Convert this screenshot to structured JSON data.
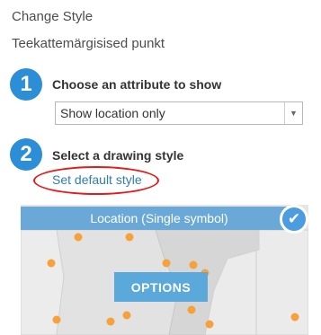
{
  "panel": {
    "title": "Change Style",
    "layer_name": "Teekattemärgisised punkt"
  },
  "steps": [
    {
      "number": "1",
      "label": "Choose an attribute to show"
    },
    {
      "number": "2",
      "label": "Select a drawing style"
    }
  ],
  "attribute_select": {
    "value": "Show location only",
    "arrow": "▼",
    "arrow_icon": "chevron-down-icon"
  },
  "default_link": "Set default style",
  "annotation_color": "#e31b1b",
  "style_card": {
    "header": "Location (Single symbol)",
    "selected_check": "✔",
    "options_label": "OPTIONS"
  },
  "colors": {
    "accent": "#2c8ed6",
    "link": "#2f7db5",
    "card_header": "#6aa8d8",
    "point_symbol": "#f7a13b"
  }
}
